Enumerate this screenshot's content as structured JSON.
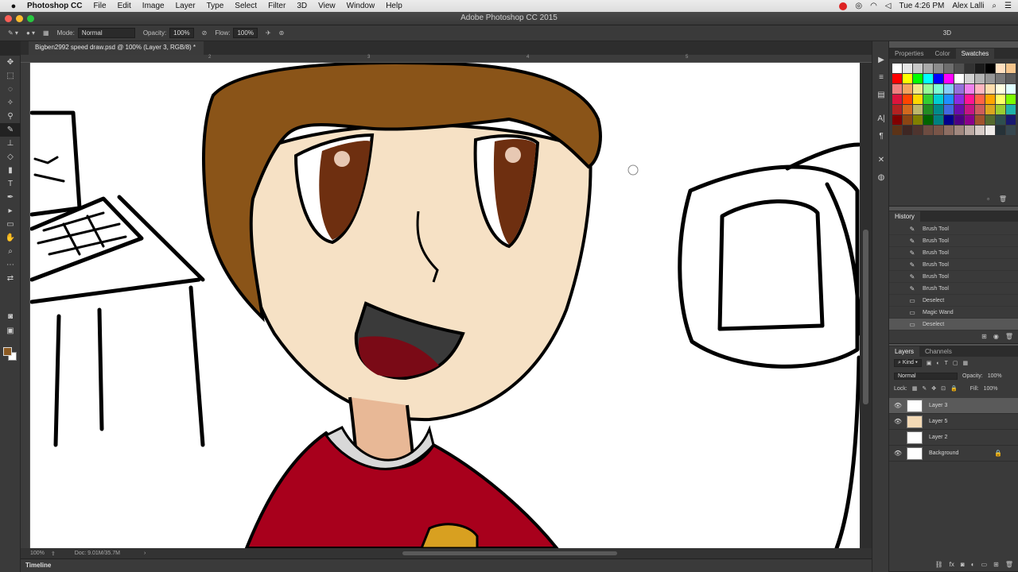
{
  "menubar": {
    "app": "Photoshop CC",
    "items": [
      "File",
      "Edit",
      "Image",
      "Layer",
      "Type",
      "Select",
      "Filter",
      "3D",
      "View",
      "Window",
      "Help"
    ],
    "clock": "Tue 4:26 PM",
    "user": "Alex Lalli"
  },
  "window": {
    "title": "Adobe Photoshop CC 2015"
  },
  "options": {
    "mode_label": "Mode:",
    "mode_value": "Normal",
    "opacity_label": "Opacity:",
    "opacity_value": "100%",
    "flow_label": "Flow:",
    "flow_value": "100%",
    "workspace": "3D"
  },
  "document": {
    "tab": "Bigben2992 speed draw.psd @ 100% (Layer 3, RGB/8) *",
    "ruler_marks": [
      "2",
      "3",
      "4",
      "5"
    ],
    "zoom": "100%",
    "doc_size": "Doc: 9.01M/35.7M"
  },
  "timeline": {
    "label": "Timeline"
  },
  "swatches_panel": {
    "tabs": [
      "Properties",
      "Color",
      "Swatches"
    ],
    "active_tab": "Swatches",
    "colors": [
      "#ffffff",
      "#e6e6e6",
      "#c8c8c8",
      "#aaaaaa",
      "#8c8c8c",
      "#6e6e6e",
      "#505050",
      "#323232",
      "#1a1a1a",
      "#000000",
      "#ffe0c0",
      "#f5c58c",
      "#ff0000",
      "#ffff00",
      "#00ff00",
      "#00ffff",
      "#0000ff",
      "#ff00ff",
      "#ffffff",
      "#d2d2d2",
      "#b4b4b4",
      "#969696",
      "#787878",
      "#5a5a5a",
      "#f08080",
      "#f4a460",
      "#f0e68c",
      "#98fb98",
      "#7fffd4",
      "#87cefa",
      "#9370db",
      "#ee82ee",
      "#ffb6c1",
      "#ffdead",
      "#ffffe0",
      "#e0ffff",
      "#dc143c",
      "#ff4500",
      "#ffd700",
      "#32cd32",
      "#00ced1",
      "#1e90ff",
      "#8a2be2",
      "#ff1493",
      "#ff6347",
      "#ffa500",
      "#ffff66",
      "#7cfc00",
      "#b22222",
      "#d2691e",
      "#bdb76b",
      "#228b22",
      "#008b8b",
      "#4169e1",
      "#6a0dad",
      "#c71585",
      "#cd5c5c",
      "#daa520",
      "#9acd32",
      "#20b2aa",
      "#800000",
      "#8b4513",
      "#808000",
      "#006400",
      "#008080",
      "#00008b",
      "#4b0082",
      "#8b008b",
      "#a0522d",
      "#556b2f",
      "#2f4f4f",
      "#191970",
      "#5c3317",
      "#3e2723",
      "#4e342e",
      "#6d4c41",
      "#795548",
      "#8d6e63",
      "#a1887f",
      "#bcaaa4",
      "#d7ccc8",
      "#efebe9",
      "#263238",
      "#37474f"
    ]
  },
  "history_panel": {
    "title": "History",
    "items": [
      "Brush Tool",
      "Brush Tool",
      "Brush Tool",
      "Brush Tool",
      "Brush Tool",
      "Brush Tool",
      "Deselect",
      "Magic Wand",
      "Deselect"
    ]
  },
  "layers_panel": {
    "tabs": [
      "Layers",
      "Channels"
    ],
    "kind_label": "Kind",
    "blend_mode": "Normal",
    "opacity_label": "Opacity:",
    "opacity_value": "100%",
    "lock_label": "Lock:",
    "fill_label": "Fill:",
    "fill_value": "100%",
    "layers": [
      {
        "name": "Layer 3",
        "visible": true,
        "selected": true
      },
      {
        "name": "Layer 5",
        "visible": true,
        "selected": false
      },
      {
        "name": "Layer 2",
        "visible": false,
        "selected": false
      },
      {
        "name": "Background",
        "visible": true,
        "selected": false,
        "locked": true
      }
    ]
  }
}
